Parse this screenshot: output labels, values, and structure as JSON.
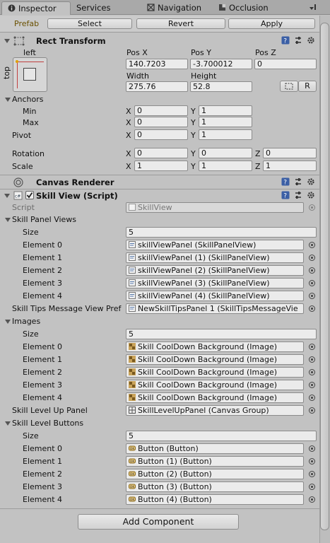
{
  "tabs": [
    {
      "label": "Inspector",
      "icon": "info-icon"
    },
    {
      "label": "Services",
      "icon": "cloud-icon"
    },
    {
      "label": "Navigation",
      "icon": "navigation-icon"
    },
    {
      "label": "Occlusion",
      "icon": "occlusion-icon"
    }
  ],
  "prefab": {
    "label": "Prefab",
    "select": "Select",
    "revert": "Revert",
    "apply": "Apply"
  },
  "rect_transform": {
    "title": "Rect Transform",
    "anchor_h": "left",
    "anchor_v": "top",
    "pos_x_label": "Pos X",
    "pos_y_label": "Pos Y",
    "pos_z_label": "Pos Z",
    "pos_x": "140.7203",
    "pos_y": "-3.700012",
    "pos_z": "0",
    "width_label": "Width",
    "height_label": "Height",
    "width": "275.76",
    "height": "52.8",
    "r_button": "R",
    "anchors_label": "Anchors",
    "min_label": "Min",
    "max_label": "Max",
    "min_x": "0",
    "min_y": "1",
    "max_x": "0",
    "max_y": "1",
    "pivot_label": "Pivot",
    "pivot_x": "0",
    "pivot_y": "1",
    "rotation_label": "Rotation",
    "rot_x": "0",
    "rot_y": "0",
    "rot_z": "0",
    "scale_label": "Scale",
    "scale_x": "1",
    "scale_y": "1",
    "scale_z": "1",
    "x": "X",
    "y": "Y",
    "z": "Z"
  },
  "canvas_renderer": {
    "title": "Canvas Renderer"
  },
  "skill_view": {
    "title": "Skill View (Script)",
    "script_label": "Script",
    "script_value": "SkillView",
    "panel_views_label": "Skill Panel Views",
    "size_label": "Size",
    "panel_views_size": "5",
    "panel_views": [
      {
        "label": "Element 0",
        "value": "skillViewPanel (SkillPanelView)"
      },
      {
        "label": "Element 1",
        "value": "skillViewPanel (1) (SkillPanelView)"
      },
      {
        "label": "Element 2",
        "value": "skillViewPanel (2) (SkillPanelView)"
      },
      {
        "label": "Element 3",
        "value": "skillViewPanel (3) (SkillPanelView)"
      },
      {
        "label": "Element 4",
        "value": "skillViewPanel (4) (SkillPanelView)"
      }
    ],
    "tips_label": "Skill Tips Message View Pref",
    "tips_value": "NewSkillTipsPanel 1 (SkillTipsMessageVie",
    "images_label": "Images",
    "images_size": "5",
    "images": [
      {
        "label": "Element 0",
        "value": "Skill CoolDown Background (Image)"
      },
      {
        "label": "Element 1",
        "value": "Skill CoolDown Background (Image)"
      },
      {
        "label": "Element 2",
        "value": "Skill CoolDown Background (Image)"
      },
      {
        "label": "Element 3",
        "value": "Skill CoolDown Background (Image)"
      },
      {
        "label": "Element 4",
        "value": "Skill CoolDown Background (Image)"
      }
    ],
    "level_up_label": "Skill Level Up Panel",
    "level_up_value": "SkillLevelUpPanel (Canvas Group)",
    "level_buttons_label": "Skill Level Buttons",
    "level_buttons_size": "5",
    "level_buttons": [
      {
        "label": "Element 0",
        "value": "Button (Button)"
      },
      {
        "label": "Element 1",
        "value": "Button (1) (Button)"
      },
      {
        "label": "Element 2",
        "value": "Button (2) (Button)"
      },
      {
        "label": "Element 3",
        "value": "Button (3) (Button)"
      },
      {
        "label": "Element 4",
        "value": "Button (4) (Button)"
      }
    ]
  },
  "add_component": "Add Component"
}
